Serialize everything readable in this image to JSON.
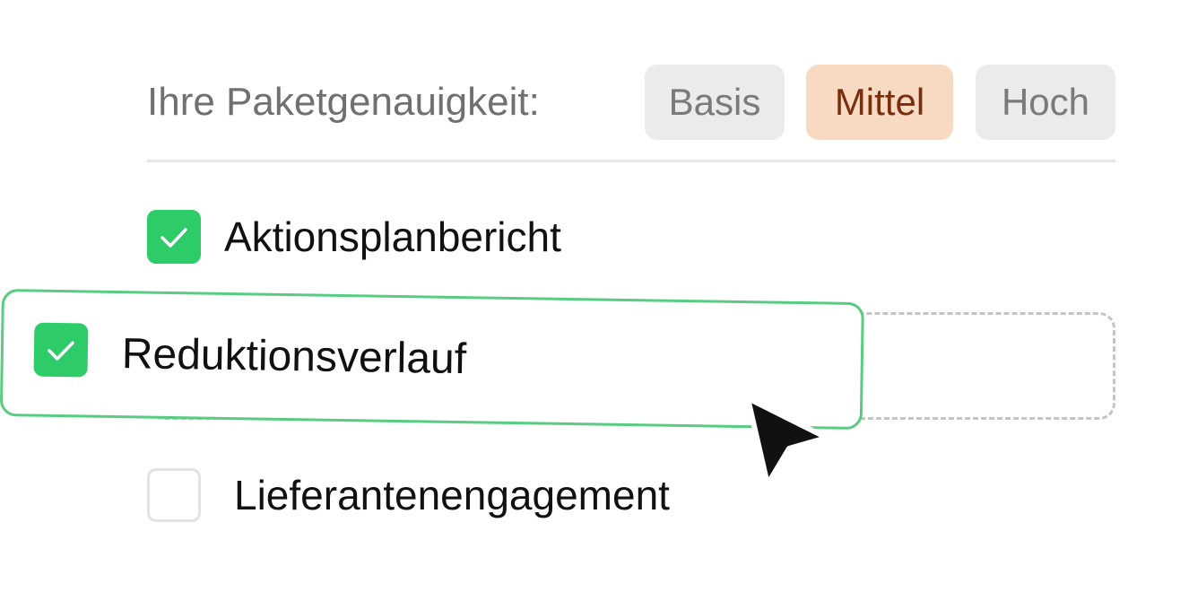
{
  "accuracy": {
    "label": "Ihre Paketgenauigkeit:",
    "options": [
      "Basis",
      "Mittel",
      "Hoch"
    ],
    "selected": "Mittel"
  },
  "report_options": [
    {
      "label": "Aktionsplanbericht",
      "checked": true
    },
    {
      "label": "Reduktionsverlauf",
      "checked": true,
      "state": "dragging"
    },
    {
      "label": "Lieferantenengagement",
      "checked": false
    }
  ],
  "colors": {
    "checkbox_checked": "#2ecc68",
    "drag_border": "#58cc82",
    "pill_selected_bg": "#f8d9c2",
    "pill_selected_text": "#7a2e0c",
    "pill_bg": "#ebebeb"
  },
  "icons": {
    "check": "check-icon",
    "cursor": "mouse-pointer-icon"
  }
}
